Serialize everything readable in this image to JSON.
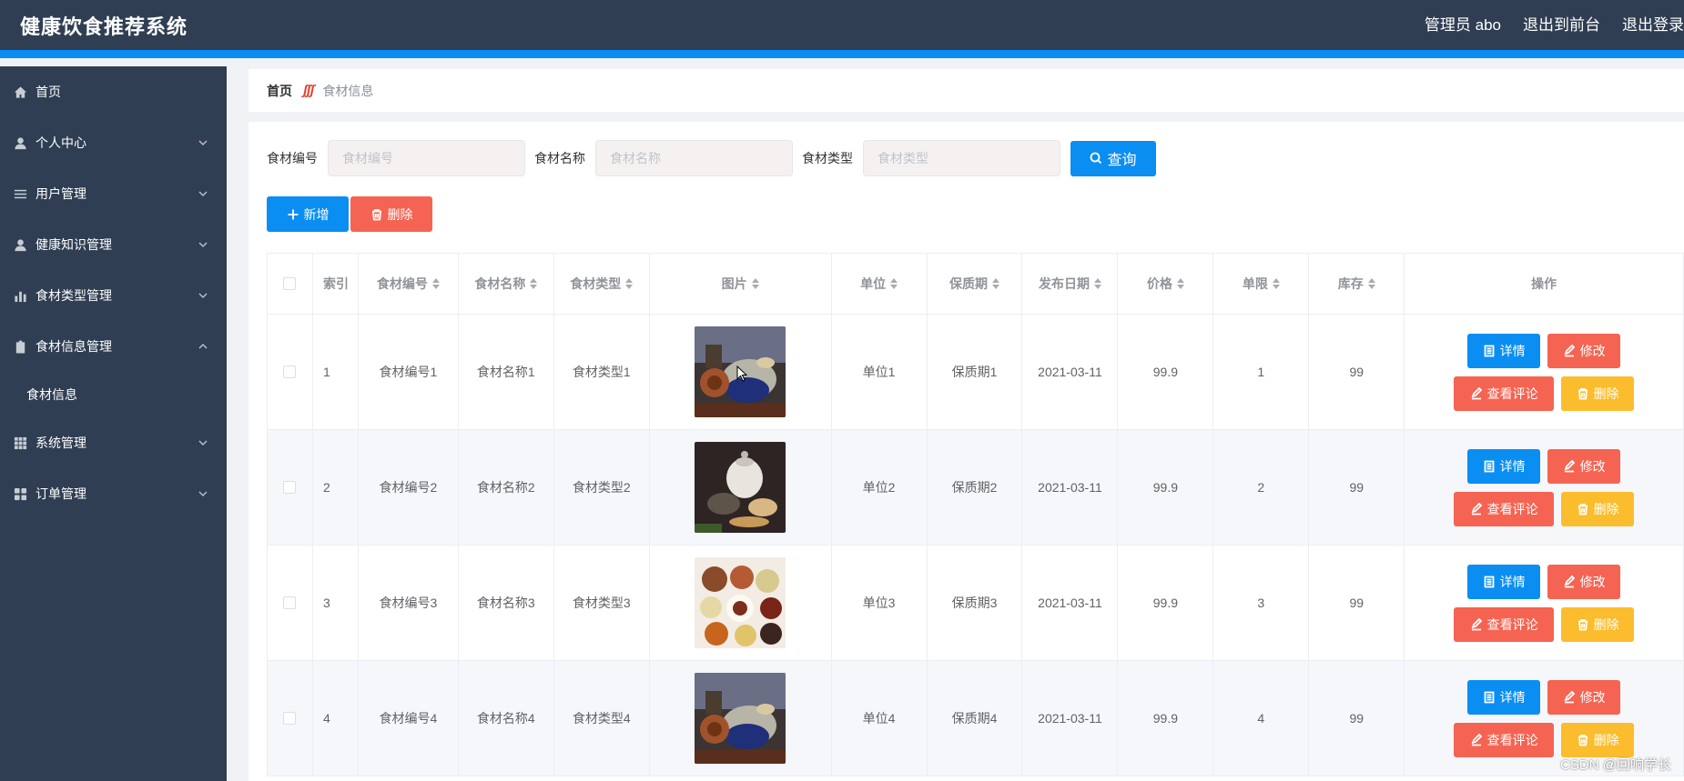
{
  "app": {
    "title": "健康饮食推荐系统",
    "top_links": {
      "admin": "管理员 abo",
      "to_front": "退出到前台",
      "logout": "退出登录"
    }
  },
  "sidebar": {
    "items": [
      {
        "label": "首页",
        "icon": "home-icon",
        "expandable": false
      },
      {
        "label": "个人中心",
        "icon": "user-icon",
        "expandable": true
      },
      {
        "label": "用户管理",
        "icon": "list-icon",
        "expandable": true
      },
      {
        "label": "健康知识管理",
        "icon": "user-icon",
        "expandable": true
      },
      {
        "label": "食材类型管理",
        "icon": "bar-chart-icon",
        "expandable": true
      },
      {
        "label": "食材信息管理",
        "icon": "clipboard-icon",
        "expandable": true,
        "expanded": true,
        "children": [
          "食材信息"
        ]
      },
      {
        "label": "系统管理",
        "icon": "grid-icon",
        "expandable": true
      },
      {
        "label": "订单管理",
        "icon": "apps-icon",
        "expandable": true
      }
    ]
  },
  "breadcrumb": {
    "home": "首页",
    "separator": "ʃʃʃ",
    "current": "食材信息"
  },
  "search": {
    "code_label": "食材编号",
    "code_placeholder": "食材编号",
    "name_label": "食材名称",
    "name_placeholder": "食材名称",
    "type_label": "食材类型",
    "type_placeholder": "食材类型",
    "query_button": "查询"
  },
  "actions": {
    "add": "新增",
    "delete": "删除"
  },
  "table": {
    "headers": {
      "index": "索引",
      "code": "食材编号",
      "name": "食材名称",
      "type": "食材类型",
      "image": "图片",
      "unit": "单位",
      "shelf": "保质期",
      "date": "发布日期",
      "price": "价格",
      "limit": "单限",
      "stock": "库存",
      "ops": "操作"
    },
    "row_buttons": {
      "detail": "详情",
      "edit": "修改",
      "review": "查看评论",
      "delete": "删除"
    },
    "rows": [
      {
        "index": "1",
        "code": "食材编号1",
        "name": "食材名称1",
        "type": "食材类型1",
        "image": "food-photo-1",
        "unit": "单位1",
        "shelf": "保质期1",
        "date": "2021-03-11",
        "price": "99.9",
        "limit": "1",
        "stock": "99"
      },
      {
        "index": "2",
        "code": "食材编号2",
        "name": "食材名称2",
        "type": "食材类型2",
        "image": "food-photo-2",
        "unit": "单位2",
        "shelf": "保质期2",
        "date": "2021-03-11",
        "price": "99.9",
        "limit": "2",
        "stock": "99"
      },
      {
        "index": "3",
        "code": "食材编号3",
        "name": "食材名称3",
        "type": "食材类型3",
        "image": "food-photo-3",
        "unit": "单位3",
        "shelf": "保质期3",
        "date": "2021-03-11",
        "price": "99.9",
        "limit": "3",
        "stock": "99"
      },
      {
        "index": "4",
        "code": "食材编号4",
        "name": "食材名称4",
        "type": "食材类型4",
        "image": "food-photo-1",
        "unit": "单位4",
        "shelf": "保质期4",
        "date": "2021-03-11",
        "price": "99.9",
        "limit": "4",
        "stock": "99"
      }
    ]
  },
  "watermark": "CSDN @回响学长",
  "colors": {
    "sidebar": "#2f3e52",
    "accent": "#0b8ef2",
    "danger": "#f56452",
    "warning": "#fbbd2d"
  }
}
